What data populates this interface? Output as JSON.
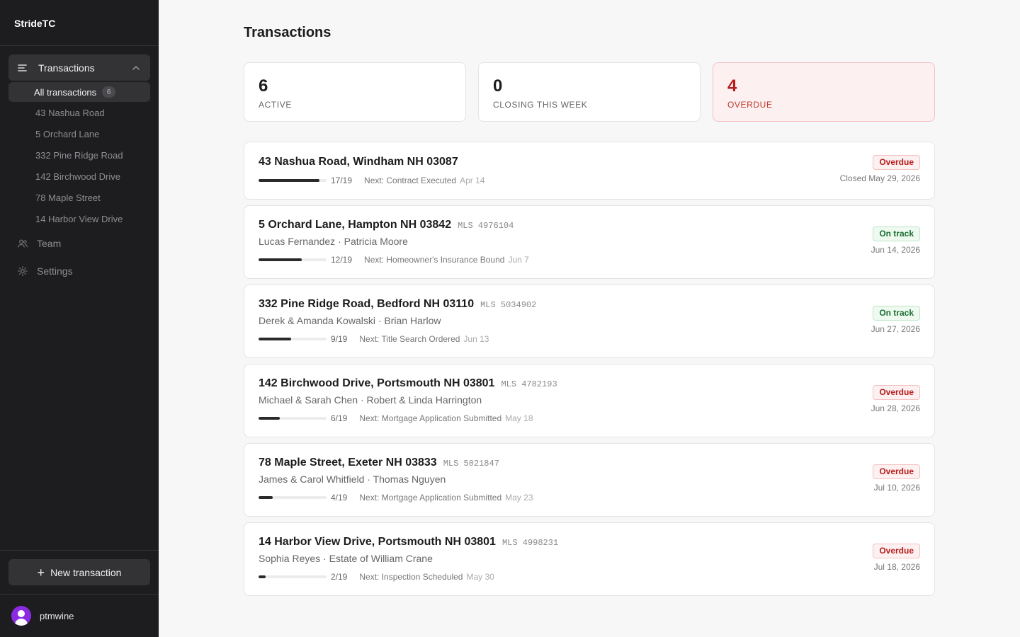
{
  "brand": "StrideTC",
  "nav": {
    "group_label": "Transactions",
    "all_label": "All transactions",
    "all_count": "6",
    "sub_items": [
      "43 Nashua Road",
      "5 Orchard Lane",
      "332 Pine Ridge Road",
      "142 Birchwood Drive",
      "78 Maple Street",
      "14 Harbor View Drive"
    ],
    "team_label": "Team",
    "settings_label": "Settings"
  },
  "sidebar_footer": {
    "new_label": "New transaction",
    "username": "ptmwine"
  },
  "page": {
    "title": "Transactions"
  },
  "stats": [
    {
      "value": "6",
      "label": "ACTIVE"
    },
    {
      "value": "0",
      "label": "CLOSING THIS WEEK"
    },
    {
      "value": "4",
      "label": "OVERDUE"
    }
  ],
  "transactions": [
    {
      "address": "43 Nashua Road, Windham NH 03087",
      "mls": "",
      "parties": "",
      "progress": 0.895,
      "fraction": "17/19",
      "next": "Next: Contract Executed",
      "next_date": "Apr 14",
      "status": "Overdue",
      "date": "Closed May 29, 2026"
    },
    {
      "address": "5 Orchard Lane, Hampton NH 03842",
      "mls": "MLS 4976104",
      "parties": "Lucas Fernandez · Patricia Moore",
      "progress": 0.632,
      "fraction": "12/19",
      "next": "Next: Homeowner's Insurance Bound",
      "next_date": "Jun 7",
      "status": "On track",
      "date": "Jun 14, 2026"
    },
    {
      "address": "332 Pine Ridge Road, Bedford NH 03110",
      "mls": "MLS 5034902",
      "parties": "Derek & Amanda Kowalski · Brian Harlow",
      "progress": 0.474,
      "fraction": "9/19",
      "next": "Next: Title Search Ordered",
      "next_date": "Jun 13",
      "status": "On track",
      "date": "Jun 27, 2026"
    },
    {
      "address": "142 Birchwood Drive, Portsmouth NH 03801",
      "mls": "MLS 4782193",
      "parties": "Michael & Sarah Chen · Robert & Linda Harrington",
      "progress": 0.316,
      "fraction": "6/19",
      "next": "Next: Mortgage Application Submitted",
      "next_date": "May 18",
      "status": "Overdue",
      "date": "Jun 28, 2026"
    },
    {
      "address": "78 Maple Street, Exeter NH 03833",
      "mls": "MLS 5021847",
      "parties": "James & Carol Whitfield · Thomas Nguyen",
      "progress": 0.211,
      "fraction": "4/19",
      "next": "Next: Mortgage Application Submitted",
      "next_date": "May 23",
      "status": "Overdue",
      "date": "Jul 10, 2026"
    },
    {
      "address": "14 Harbor View Drive, Portsmouth NH 03801",
      "mls": "MLS 4998231",
      "parties": "Sophia Reyes · Estate of William Crane",
      "progress": 0.105,
      "fraction": "2/19",
      "next": "Next: Inspection Scheduled",
      "next_date": "May 30",
      "status": "Overdue",
      "date": "Jul 18, 2026"
    }
  ]
}
